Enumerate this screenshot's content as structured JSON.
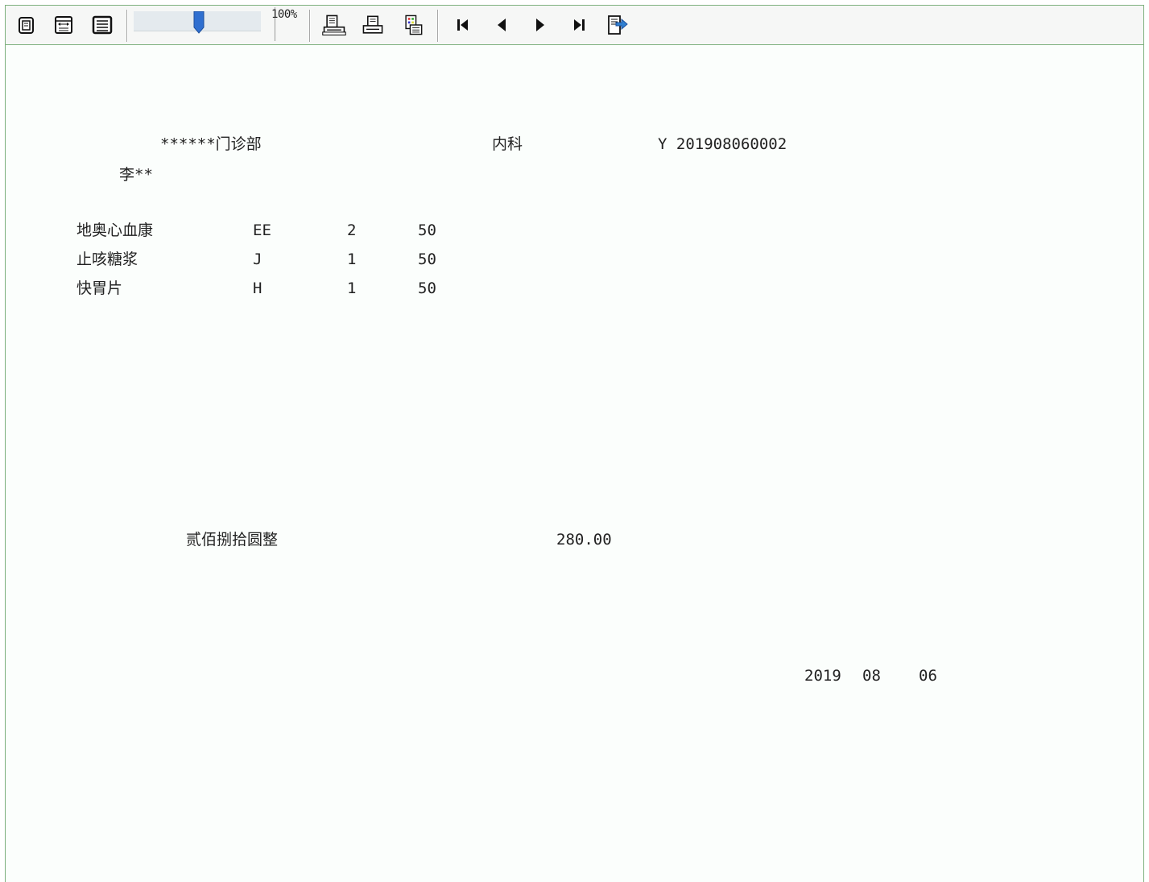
{
  "toolbar": {
    "zoom_label": "100%",
    "zoom_level_percent": 100,
    "buttons": [
      "single-page-icon",
      "fit-width-icon",
      "whole-page-icon",
      "print-preview-icon",
      "print-icon",
      "page-setup-icon",
      "first-page-icon",
      "previous-page-icon",
      "next-page-icon",
      "last-page-icon",
      "export-icon"
    ]
  },
  "receipt": {
    "clinic": "******门诊部",
    "department": "内科",
    "receipt_no": "Y 201908060002",
    "patient": "李**",
    "items": [
      {
        "name": "地奥心血康",
        "code": "EE",
        "qty": "2",
        "amount": "50"
      },
      {
        "name": "止咳糖浆",
        "code": "J",
        "qty": "1",
        "amount": "50"
      },
      {
        "name": "快胃片",
        "code": "H",
        "qty": "1",
        "amount": "50"
      }
    ],
    "total_in_words": "贰佰捌拾圆整",
    "total": "280.00",
    "date": {
      "year": "2019",
      "month": "08",
      "day": "06"
    }
  }
}
